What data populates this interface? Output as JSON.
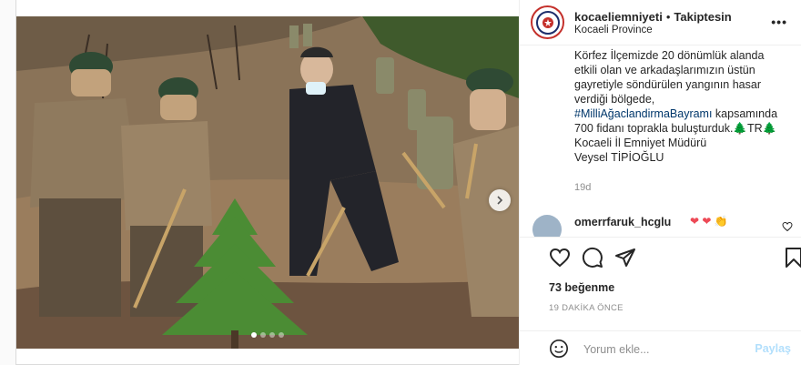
{
  "header": {
    "username": "kocaeliemniyeti",
    "separator": "•",
    "follow_label": "Takiptesin",
    "location": "Kocaeli Province",
    "more_label": "•••"
  },
  "caption": {
    "line1": "Körfez İlçemizde 20 dönümlük alanda",
    "line2": "etkili olan ve arkadaşlarımızın üstün",
    "line3": "gayretiyle söndürülen yangının hasar",
    "line4": "verdiği bölgede,",
    "hashtag": "#MilliAğaclandirmaBayramı",
    "line5_rest": " kapsamında",
    "line6": "700 fidanı toprakla buluşturduk.",
    "line6_emoji": "🌲TR🌲",
    "line7": "Kocaeli İl Emniyet Müdürü",
    "line8": "Veysel TİPİOĞLU"
  },
  "time_ago": "19d",
  "comment": {
    "username": "omerrfaruk_hcglu",
    "hearts": "❤ ❤",
    "clap": "👏"
  },
  "actions": {
    "likes": "73 beğenme",
    "posted": "19 DAKİKA ÖNCE"
  },
  "add_comment": {
    "placeholder": "Yorum ekle...",
    "post_label": "Paylaş"
  },
  "carousel": {
    "slide_count": 4,
    "active_index": 0
  },
  "colors": {
    "hashtag": "#00376b",
    "secondary_text": "#8e8e8e",
    "post_button_disabled": "#b2dffc",
    "avatar_ring": "#c4302b",
    "heart": "#ed4956"
  }
}
